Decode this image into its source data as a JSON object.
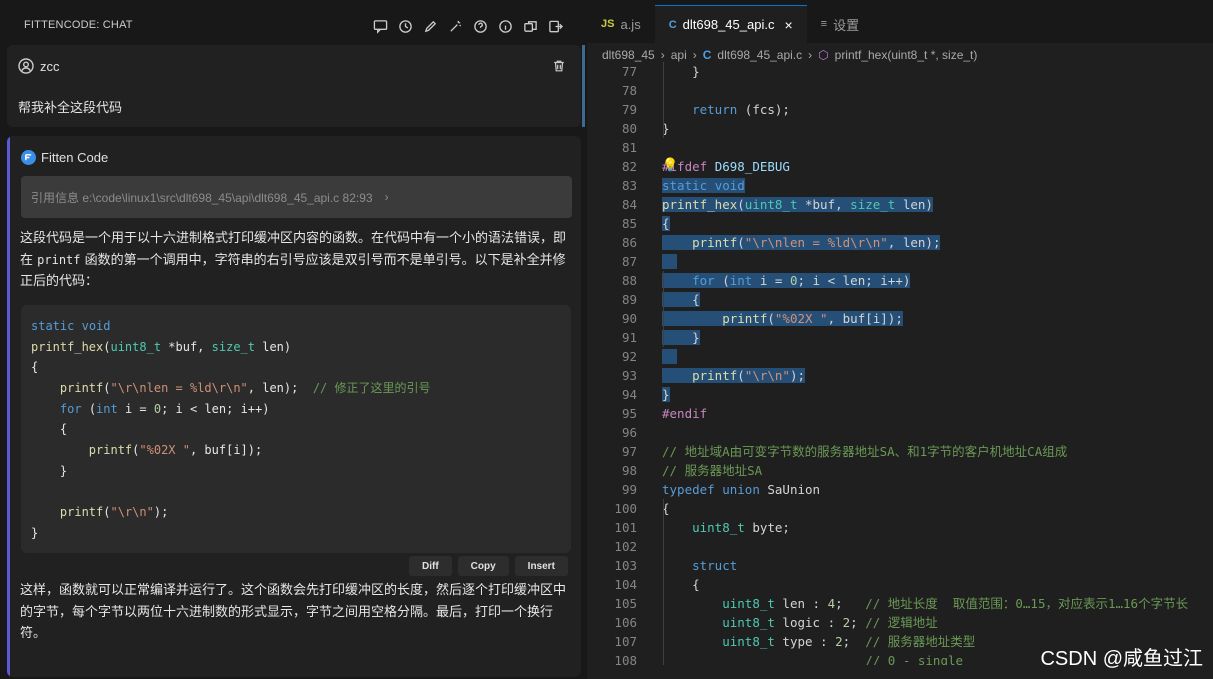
{
  "chat": {
    "title": "FITTENCODE: CHAT",
    "toolbar_icons": [
      "new-chat-icon",
      "history-icon",
      "edit-icon",
      "magic-wand-icon",
      "help-icon",
      "info-icon",
      "copy-window-icon",
      "export-icon"
    ],
    "user": {
      "name": "zcc",
      "message": "帮我补全这段代码"
    },
    "bot": {
      "name": "Fitten Code",
      "reference": "引用信息 e:\\code\\linux1\\src\\dlt698_45\\api\\dlt698_45_api.c 82:93",
      "intro_1": "这段代码是一个用于以十六进制格式打印缓冲区内容的函数。在代码中有一个小的语法错误，即",
      "intro_2a": "在",
      "intro_code": "printf",
      "intro_2b": "函数的第一个调用中，字符串的右引号应该是双引号而不是单引号。以下是补全并修",
      "intro_3": "正后的代码：",
      "code_lines": [
        "static void",
        "printf_hex(uint8_t *buf, size_t len)",
        "{",
        "    printf(\"\\r\\nlen = %ld\\r\\n\", len);  // 修正了这里的引号",
        "    for (int i = 0; i < len; i++)",
        "    {",
        "        printf(\"%02X \", buf[i]);",
        "    }",
        "",
        "    printf(\"\\r\\n\");",
        "}"
      ],
      "actions": [
        "Diff",
        "Copy",
        "Insert"
      ],
      "outro_1": "这样，函数就可以正常编译并运行了。这个函数会先打印缓冲区的长度，然后逐个打印缓冲区中",
      "outro_2": "的字节，每个字节以两位十六进制数的形式显示，字节之间用空格分隔。最后，打印一个换行",
      "outro_3": "符。"
    }
  },
  "editor": {
    "tabs": [
      {
        "icon": "JS",
        "label": "a.js"
      },
      {
        "icon": "C",
        "label": "dlt698_45_api.c",
        "close": "×"
      },
      {
        "icon": "≡",
        "label": "设置"
      }
    ],
    "breadcrumb": [
      "dlt698_45",
      "api",
      "dlt698_45_api.c",
      "printf_hex(uint8_t *, size_t)"
    ],
    "line_numbers": [
      "77",
      "78",
      "79",
      "80",
      "81",
      "82",
      "83",
      "84",
      "85",
      "86",
      "87",
      "88",
      "89",
      "90",
      "91",
      "92",
      "93",
      "94",
      "95",
      "96",
      "97",
      "98",
      "99",
      "100",
      "101",
      "102",
      "103",
      "104",
      "105",
      "106",
      "107",
      "108"
    ],
    "lines": [
      "    }",
      "",
      "    return (fcs);",
      "}",
      "",
      "#ifdef D698_DEBUG",
      "static void",
      "printf_hex(uint8_t *buf, size_t len)",
      "{",
      "    printf(\"\\r\\nlen = %ld\\r\\n\", len);",
      "",
      "    for (int i = 0; i < len; i++)",
      "    {",
      "        printf(\"%02X \", buf[i]);",
      "    }",
      "",
      "    printf(\"\\r\\n\");",
      "}",
      "#endif",
      "",
      "// 地址域A由可变字节数的服务器地址SA、和1字节的客户机地址CA组成",
      "// 服务器地址SA",
      "typedef union SaUnion",
      "{",
      "    uint8_t byte;",
      "",
      "    struct",
      "    {",
      "        uint8_t len : 4;   // 地址长度  取值范围：0…15，对应表示1…16个字节长",
      "        uint8_t logic : 2; // 逻辑地址",
      "        uint8_t type : 2;  // 服务器地址类型",
      "                           // 0 - single"
    ],
    "watermark": "CSDN @咸鱼过江"
  }
}
